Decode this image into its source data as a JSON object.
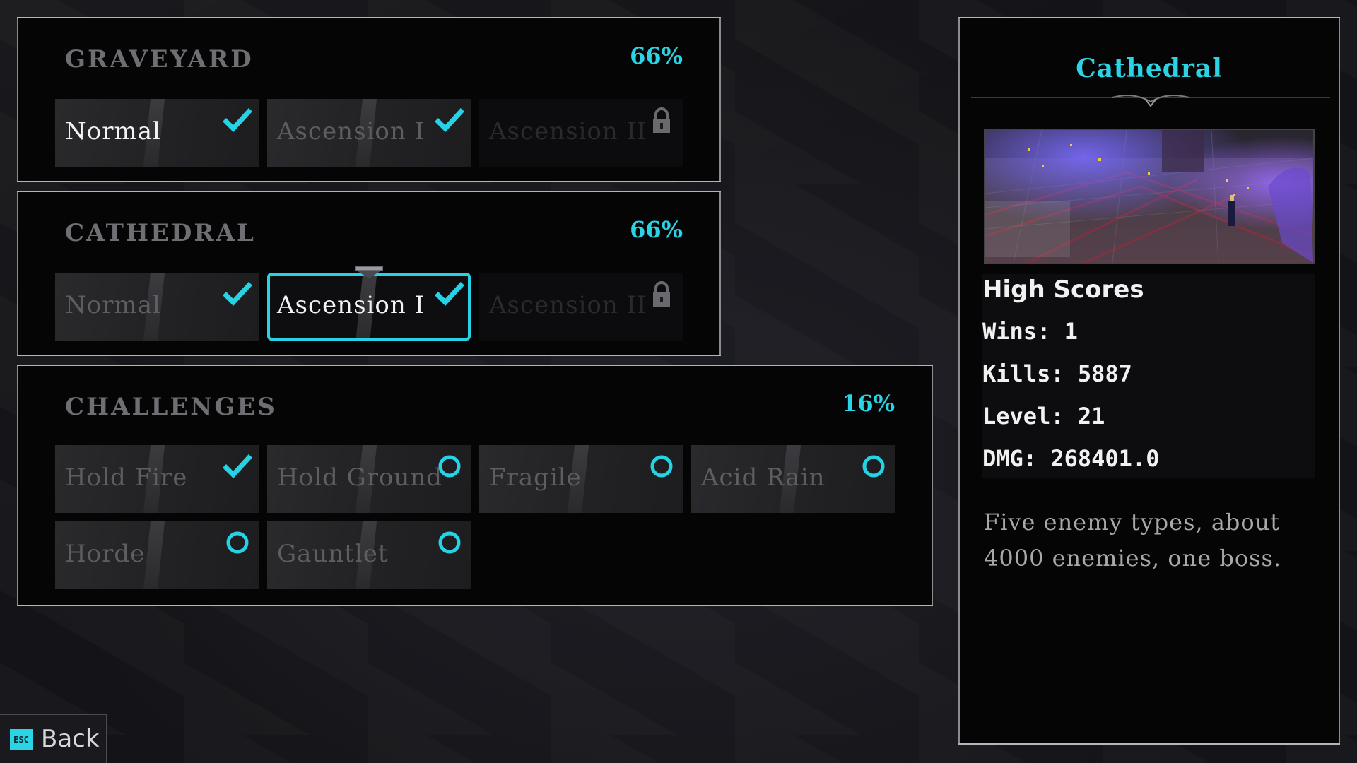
{
  "colors": {
    "accent": "#2bd3e4",
    "panel": "#050506",
    "border": "#8c8c90"
  },
  "sections": {
    "graveyard": {
      "title": "GRAVEYARD",
      "percent": "66%",
      "options": [
        {
          "label": "Normal",
          "status": "complete",
          "icon": "check-icon"
        },
        {
          "label": "Ascension I",
          "status": "complete",
          "icon": "check-icon"
        },
        {
          "label": "Ascension II",
          "status": "locked",
          "icon": "lock-icon"
        }
      ]
    },
    "cathedral": {
      "title": "CATHEDRAL",
      "percent": "66%",
      "options": [
        {
          "label": "Normal",
          "status": "complete",
          "icon": "check-icon"
        },
        {
          "label": "Ascension I",
          "status": "complete-selected",
          "icon": "check-icon"
        },
        {
          "label": "Ascension II",
          "status": "locked",
          "icon": "lock-icon"
        }
      ]
    },
    "challenges": {
      "title": "CHALLENGES",
      "percent": "16%",
      "options": [
        {
          "label": "Hold Fire",
          "status": "complete",
          "icon": "check-icon"
        },
        {
          "label": "Hold Ground",
          "status": "incomplete",
          "icon": "ring-icon"
        },
        {
          "label": "Fragile",
          "status": "incomplete",
          "icon": "ring-icon"
        },
        {
          "label": "Acid Rain",
          "status": "incomplete",
          "icon": "ring-icon"
        },
        {
          "label": "Horde",
          "status": "incomplete",
          "icon": "ring-icon"
        },
        {
          "label": "Gauntlet",
          "status": "incomplete",
          "icon": "ring-icon"
        }
      ]
    }
  },
  "detail": {
    "title": "Cathedral",
    "scores_heading": "High Scores",
    "wins": "Wins: 1",
    "kills": "Kills: 5887",
    "level": "Level: 21",
    "dmg": "DMG: 268401.0",
    "description": "Five enemy types, about 4000 enemies, one boss."
  },
  "footer": {
    "esc_key": "ESC",
    "back_label": "Back"
  }
}
